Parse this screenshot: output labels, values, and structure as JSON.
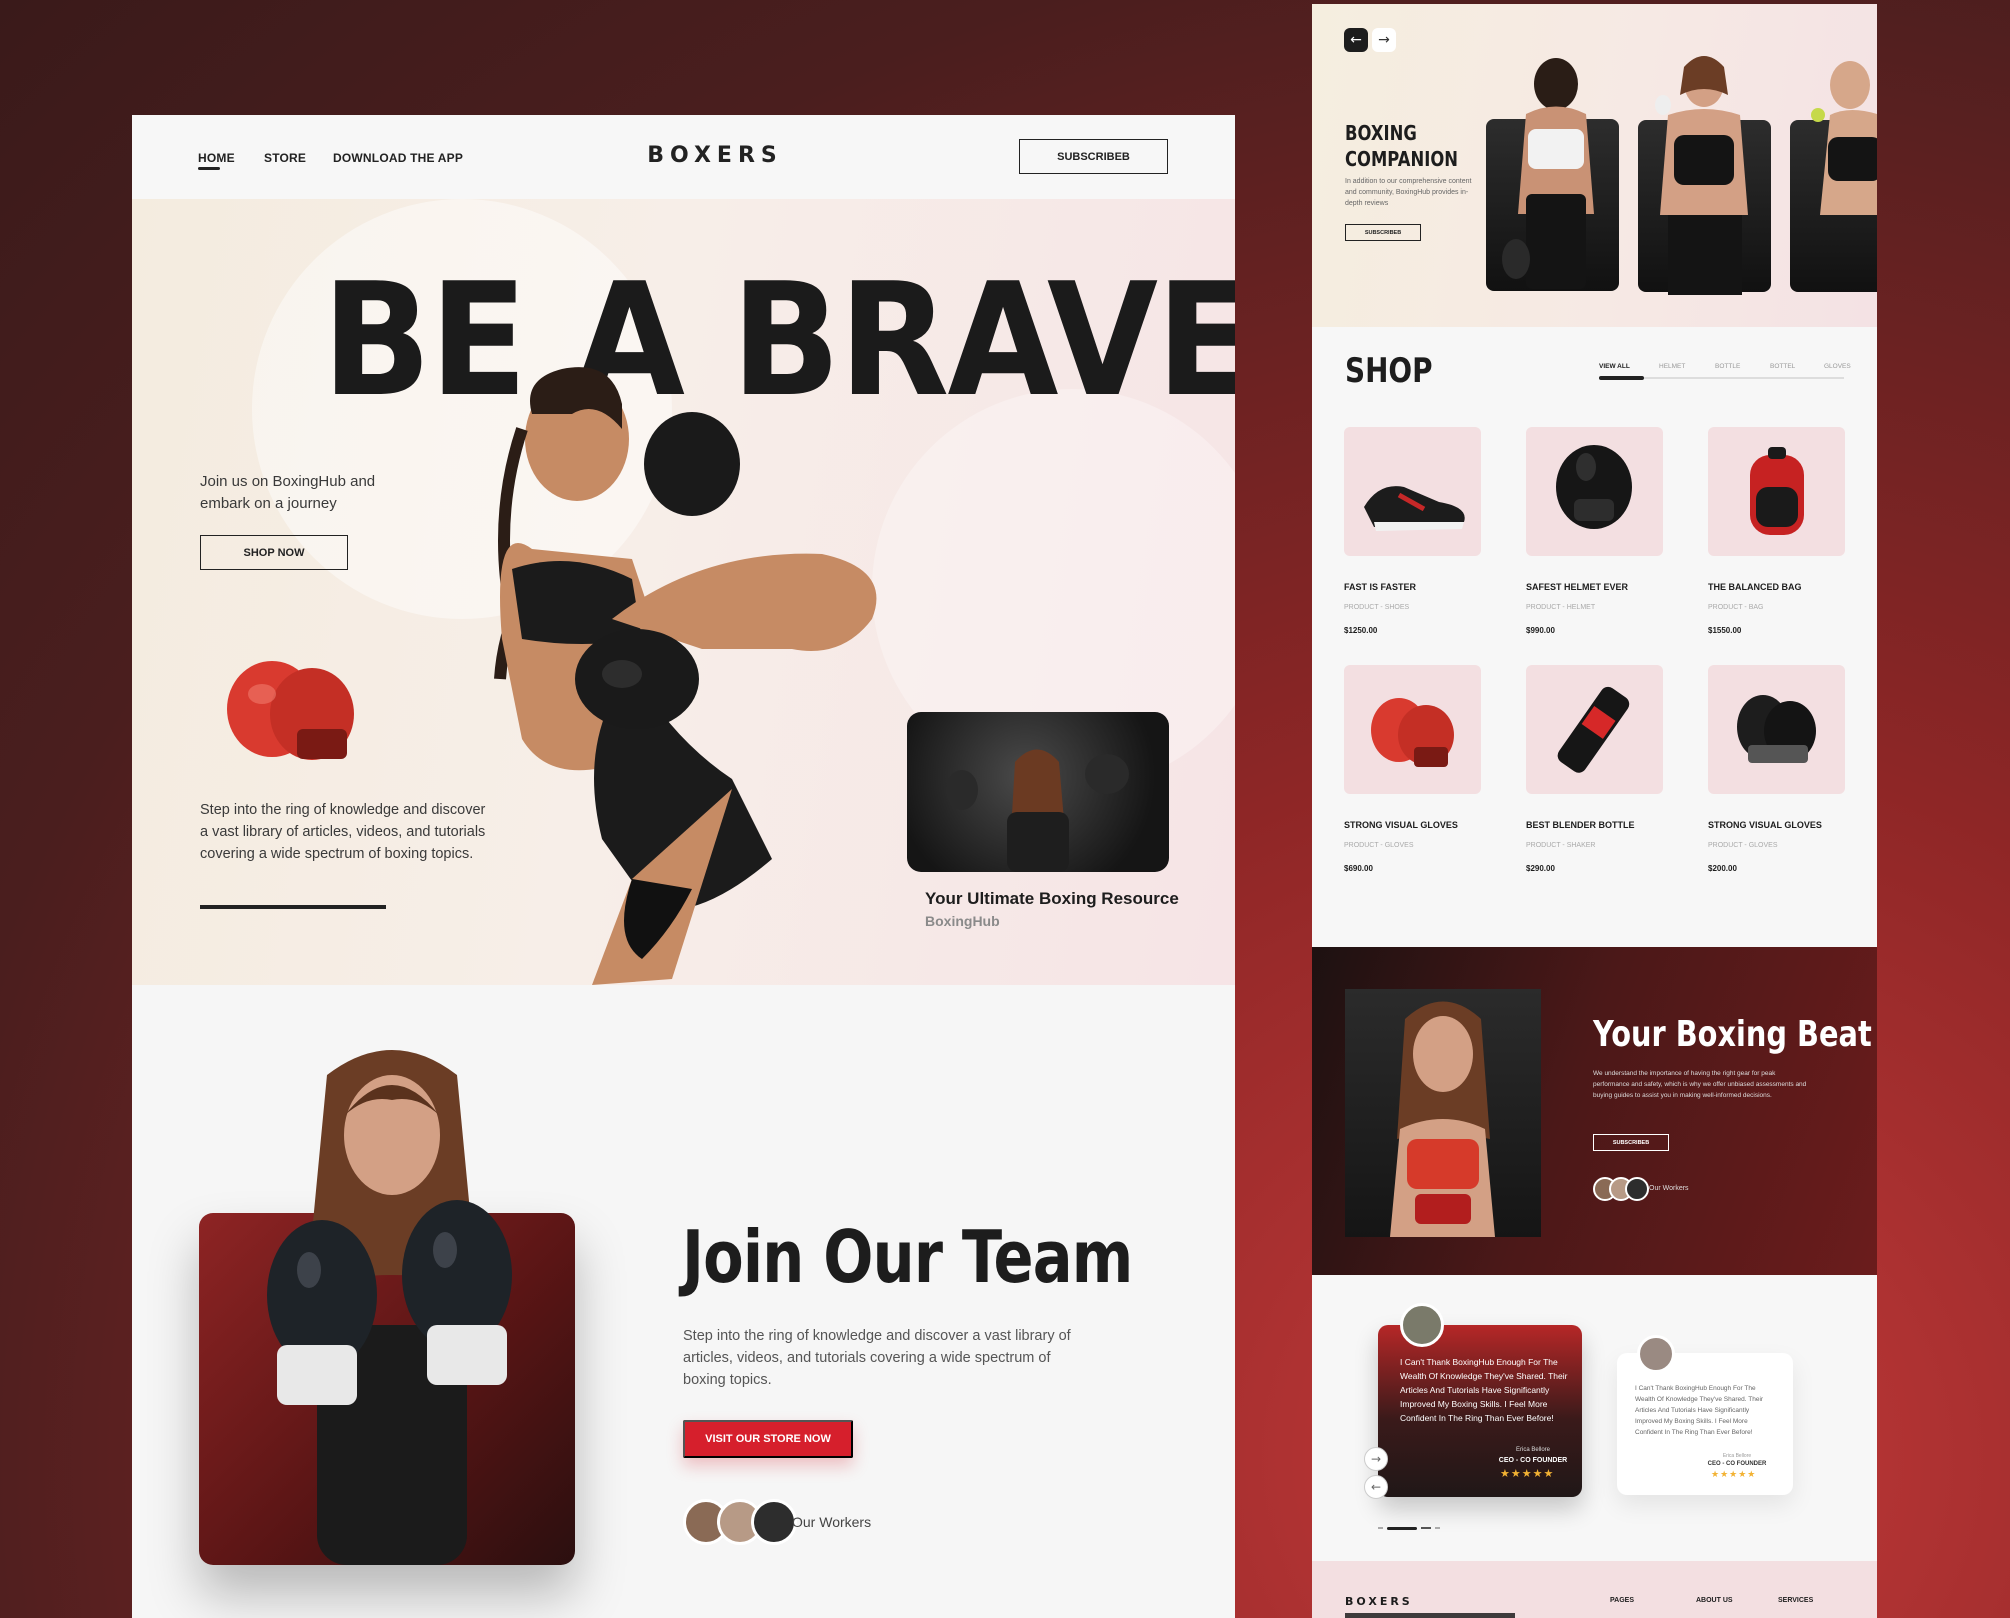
{
  "landing": {
    "nav": {
      "home": "HOME",
      "store": "STORE",
      "download": "DOWNLOAD THE APP",
      "subscribe": "SUBSCRIBEB"
    },
    "brand": "BOXERS",
    "hero": {
      "title": "BE A BRAVE",
      "intro": "Join us on BoxingHub and embark on a journey",
      "shop_button": "SHOP NOW",
      "description": "Step into the ring of knowledge and discover a vast library of articles, videos, and tutorials covering a wide spectrum of boxing topics."
    },
    "video_card": {
      "title": "Your Ultimate Boxing Resource",
      "subtitle": "BoxingHub"
    },
    "team": {
      "title": "Join Our Team",
      "description": "Step into the ring of knowledge and discover a vast library of articles, videos, and tutorials covering a wide spectrum of boxing topics.",
      "button": "VISIT OUR STORE NOW",
      "workers_label": "Our Workers"
    }
  },
  "right": {
    "companion": {
      "title_line1": "BOXING",
      "title_line2": "COMPANION",
      "description": "In addition to our comprehensive content and community, BoxingHub provides in-depth reviews",
      "button": "SUBSCRIBEB",
      "prev_icon": "←",
      "next_icon": "→"
    },
    "shop": {
      "title": "SHOP",
      "tabs": [
        "VIEW ALL",
        "HELMET",
        "BOTTLE",
        "BOTTEL",
        "GLOVES"
      ],
      "products": [
        {
          "name": "FAST IS FASTER",
          "category": "PRODUCT - SHOES",
          "price": "$1250.00"
        },
        {
          "name": "SAFEST HELMET EVER",
          "category": "PRODUCT - HELMET",
          "price": "$990.00"
        },
        {
          "name": "THE BALANCED BAG",
          "category": "PRODUCT - BAG",
          "price": "$1550.00"
        },
        {
          "name": "STRONG VISUAL GLOVES",
          "category": "PRODUCT - GLOVES",
          "price": "$690.00"
        },
        {
          "name": "BEST BLENDER BOTTLE",
          "category": "PRODUCT - SHAKER",
          "price": "$290.00"
        },
        {
          "name": "STRONG VISUAL GLOVES",
          "category": "PRODUCT - GLOVES",
          "price": "$200.00"
        }
      ]
    },
    "beat": {
      "title": "Your Boxing Beat",
      "description": "We understand the importance of having the right gear for peak performance and safety, which is why we offer unbiased assessments and buying guides to assist you in making well-informed decisions.",
      "button": "SUBSCRIBEB",
      "workers_label": "Our Workers"
    },
    "testimonials": [
      {
        "text": "I Can't Thank BoxingHub Enough For The Wealth Of Knowledge They've Shared. Their Articles And Tutorials Have Significantly Improved My Boxing Skills. I Feel More Confident In The Ring Than Ever Before!",
        "name": "Erica Bellore",
        "role": "CEO - CO FOUNDER",
        "stars": "★★★★★"
      },
      {
        "text": "I Can't Thank BoxingHub Enough For The Wealth Of Knowledge They've Shared. Their Articles And Tutorials Have Significantly Improved My Boxing Skills. I Feel More Confident In The Ring Than Ever Before!",
        "name": "Erica Bellore",
        "role": "CEO - CO FOUNDER",
        "stars": "★★★★★"
      }
    ],
    "footer": {
      "brand": "BOXERS",
      "col1": "PAGES",
      "col2": "ABOUT US",
      "col3": "SERVICES"
    }
  },
  "colors": {
    "accent_red": "#d61f2c",
    "dark": "#1d1d1d",
    "tile_pink": "#f3dfe1",
    "star": "#f2b233"
  }
}
